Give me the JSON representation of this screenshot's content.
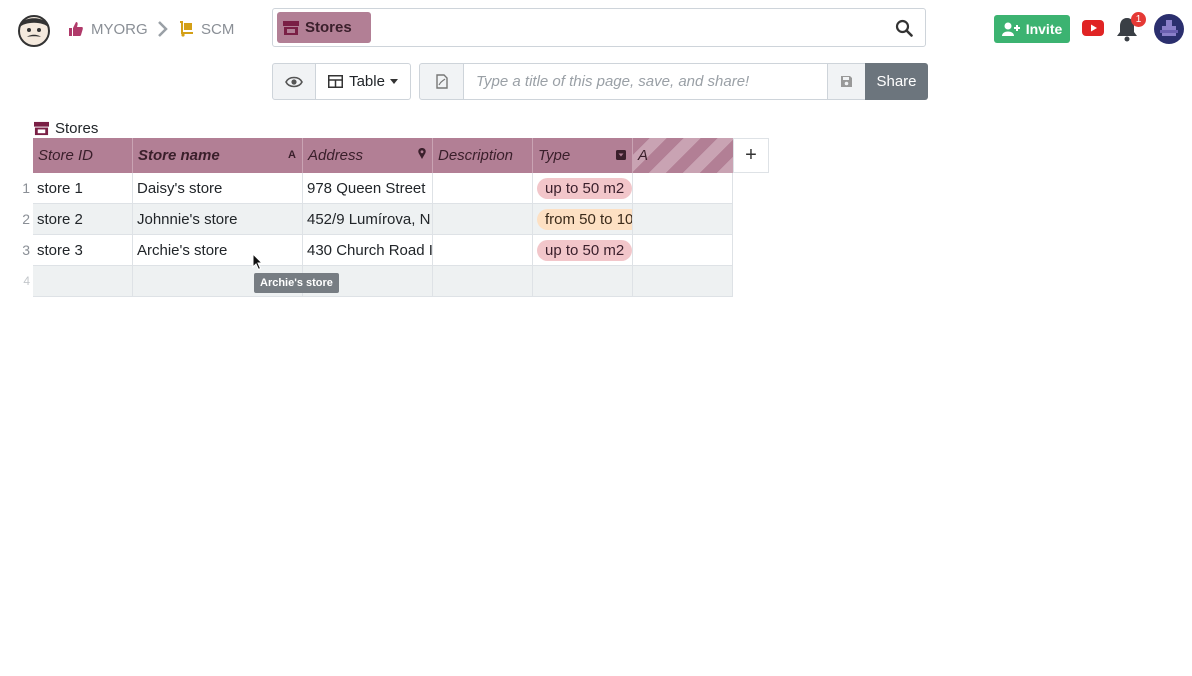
{
  "breadcrumb": {
    "org": "MYORG",
    "project": "SCM"
  },
  "search": {
    "table_chip": "Stores"
  },
  "header": {
    "invite_label": "Invite",
    "notification_count": "1"
  },
  "toolbar": {
    "view_label": "Table",
    "title_placeholder": "Type a title of this page, save, and share!",
    "share_label": "Share"
  },
  "table": {
    "title": "Stores",
    "columns": [
      {
        "label": "Store ID",
        "type_mark": ""
      },
      {
        "label": "Store name",
        "type_mark": "A"
      },
      {
        "label": "Address",
        "type_mark": "location-pin-icon"
      },
      {
        "label": "Description",
        "type_mark": ""
      },
      {
        "label": "Type",
        "type_mark": "dropdown-icon"
      },
      {
        "label": "A",
        "type_mark": ""
      }
    ],
    "rows": [
      {
        "num": "1",
        "cells": [
          "store 1",
          "Daisy's store",
          "978 Queen Street",
          "",
          "up to 50 m2",
          ""
        ]
      },
      {
        "num": "2",
        "cells": [
          "store 2",
          "Johnnie's store",
          "452/9 Lumírova, N",
          "",
          "from 50 to 10",
          ""
        ]
      },
      {
        "num": "3",
        "cells": [
          "store 3",
          "Archie's store",
          "430 Church Road I",
          "",
          "up to 50 m2",
          ""
        ]
      }
    ],
    "empty_row_num": "4"
  },
  "tooltip": {
    "text": "Archie's store"
  },
  "colors": {
    "header_bg": "#b27f95",
    "invite_green": "#3cb371",
    "share_gray": "#6c757d",
    "pill_small": "#f2c6ca",
    "pill_medium": "#fde0c3"
  }
}
